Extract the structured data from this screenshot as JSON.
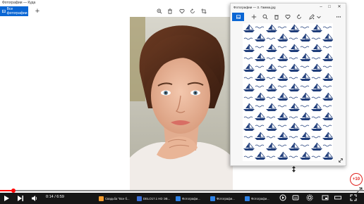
{
  "main_window": {
    "title": "Фотографии — Куда",
    "all_photos_label": "Все фотографии",
    "add_label": "+",
    "toolbar_icons": [
      "zoom-in-icon",
      "delete-icon",
      "heart-icon",
      "rotate-icon",
      "crop-icon"
    ]
  },
  "viewer_window": {
    "title": "Фотографии — 3. Гамма.jpg",
    "controls": {
      "minimize": "–",
      "maximize": "□",
      "close": "✕"
    },
    "toolbar_icons": [
      "add-icon",
      "zoom-in-icon",
      "delete-icon",
      "heart-icon",
      "rotate-icon",
      "edit-icon",
      "more-icon"
    ]
  },
  "badge": {
    "label": "+10"
  },
  "video": {
    "progress": 0.037,
    "time_label": "0:14 / 6:59"
  },
  "taskbar": {
    "items": [
      {
        "label": "Свадьба \"Все б...",
        "color": "#f29b2e"
      },
      {
        "label": "DELO17.1 HD ЭВ...",
        "color": "#3b6fd6"
      },
      {
        "label": "Фотографи...",
        "color": "#2e82e6"
      },
      {
        "label": "Фотографи...",
        "color": "#2e82e6"
      },
      {
        "label": "Фотографи...",
        "color": "#2e82e6"
      }
    ]
  },
  "colors": {
    "accent": "#0a66d4",
    "progress": "#ff0000",
    "taskbar": "#161616",
    "pattern_ink": "#1f3d7a"
  }
}
